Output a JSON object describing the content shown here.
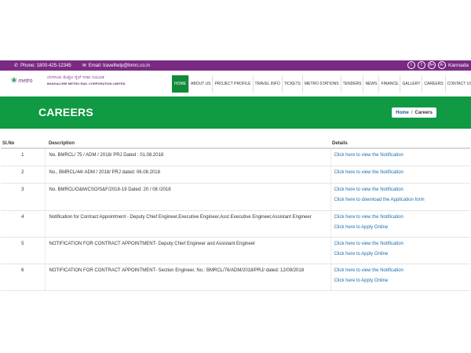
{
  "topbar": {
    "phone_icon": "phone-icon",
    "phone": "Phone: 1800-425-12345",
    "email_icon": "mail-icon",
    "email": "Email: travelhelp@bmrc.co.in",
    "social": [
      "twitter-icon",
      "facebook-icon"
    ],
    "font_increase": "A+",
    "font_decrease": "A-",
    "language": "Kannada"
  },
  "logo": {
    "mark": "metro",
    "kannada": "ಬೆಂಗಳೂರು ಮೆಟ್ರೋ ರೈಲ್ ನಿಗಮ ನಿಯಮಿತ",
    "english": "BANGALORE METRO RAIL CORPORATION LIMITED"
  },
  "nav": {
    "items": [
      "HOME",
      "ABOUT US",
      "PROJECT PROFILE",
      "TRAVEL INFO",
      "TICKETS",
      "METRO STATIONS",
      "TENDERS",
      "NEWS",
      "FINANCE",
      "GALLERY",
      "CAREERS",
      "CONTACT US"
    ],
    "active_index": 0
  },
  "banner": {
    "title": "CAREERS",
    "breadcrumb_home": "Home",
    "breadcrumb_sep": "/",
    "breadcrumb_current": "Careers"
  },
  "table": {
    "headers": {
      "no": "Sl.No",
      "desc": "Description",
      "details": "Details"
    },
    "rows": [
      {
        "no": "1",
        "desc": "No. BMRCL/ 75 / ADM / 2018/ PRJ Dated : 01.08.2018",
        "links": [
          "Click here to view the Notification"
        ]
      },
      {
        "no": "2",
        "desc": "No., BMRCL/44/ ADM / 2018/ PRJ dated: 06.08.2018",
        "links": [
          "Click here to view the Notification"
        ]
      },
      {
        "no": "3",
        "desc": "No. BMRCL/O&M/CSO/S&F/2018-19 Dated: 20 / 08 /2018",
        "links": [
          "Click here to view the Notification",
          "Click here to download the Application form"
        ]
      },
      {
        "no": "4",
        "desc": "Notification for Contract Appointment - Deputy Chief Engineer,Executive Engineer,Asst Executive Engineer,Assistant Engineer",
        "links": [
          "Click here to view the Notification",
          "Click here to Apply Online"
        ]
      },
      {
        "no": "5",
        "desc": "NOTIFICATION FOR CONTRACT APPOINTMENT- Deputy Chief Engineer and Assistant Engineer",
        "links": [
          "Click here to view the Notification",
          "Click here to Apply Online"
        ]
      },
      {
        "no": "6",
        "desc": "NOTIFICATION FOR CONTRACT APPOINTMENT- Section Engineer, No.: BMRCL/76/ADM/2018/PRJ/ dated: 12/09/2018",
        "links": [
          "Click here to view the Notification",
          "Click here to Apply Online"
        ]
      }
    ]
  },
  "colors": {
    "topbar": "#7a2a83",
    "banner": "#0f9a43",
    "nav_active": "#128a3c",
    "link": "#1a6fb0"
  }
}
